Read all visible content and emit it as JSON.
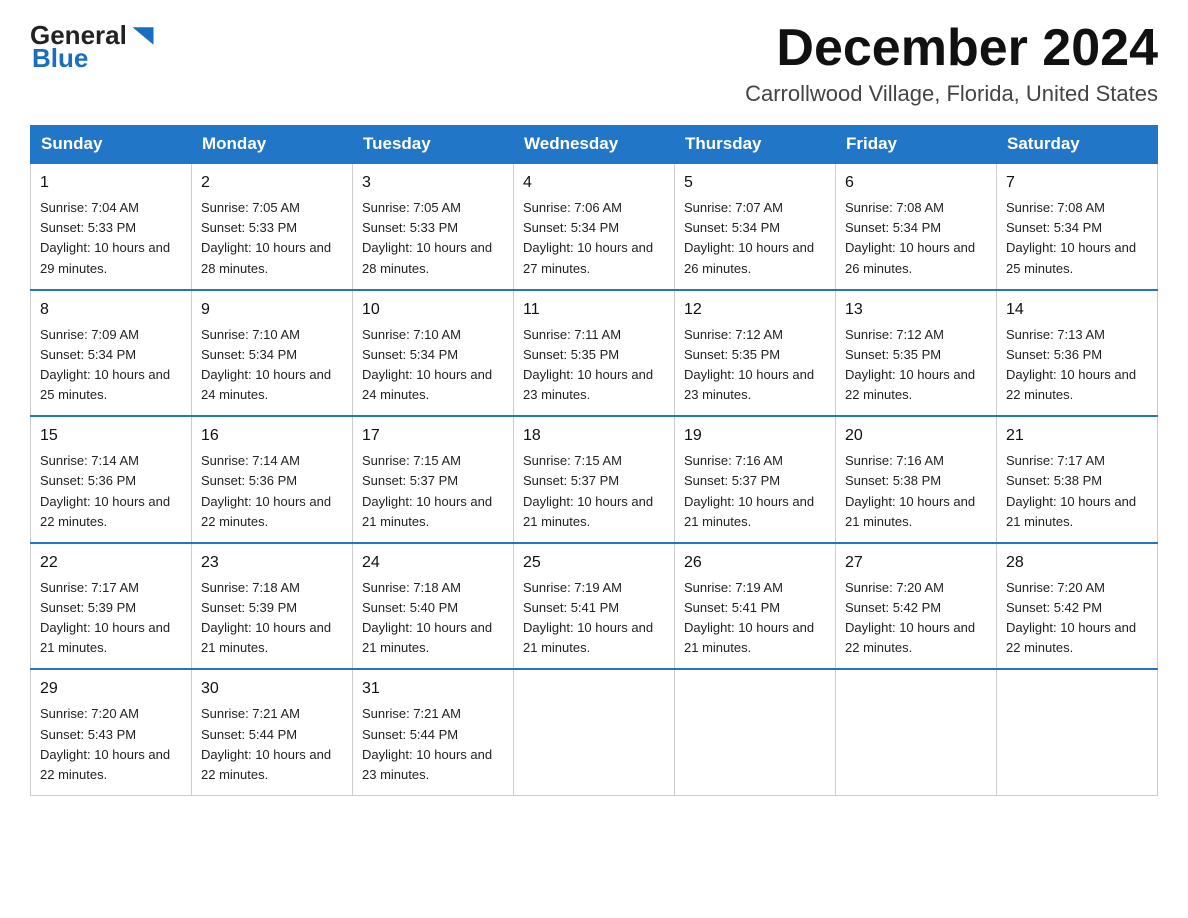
{
  "header": {
    "logo_general": "General",
    "logo_blue": "Blue",
    "month": "December 2024",
    "location": "Carrollwood Village, Florida, United States"
  },
  "weekdays": [
    "Sunday",
    "Monday",
    "Tuesday",
    "Wednesday",
    "Thursday",
    "Friday",
    "Saturday"
  ],
  "weeks": [
    [
      {
        "day": "1",
        "sunrise": "7:04 AM",
        "sunset": "5:33 PM",
        "daylight": "10 hours and 29 minutes."
      },
      {
        "day": "2",
        "sunrise": "7:05 AM",
        "sunset": "5:33 PM",
        "daylight": "10 hours and 28 minutes."
      },
      {
        "day": "3",
        "sunrise": "7:05 AM",
        "sunset": "5:33 PM",
        "daylight": "10 hours and 28 minutes."
      },
      {
        "day": "4",
        "sunrise": "7:06 AM",
        "sunset": "5:34 PM",
        "daylight": "10 hours and 27 minutes."
      },
      {
        "day": "5",
        "sunrise": "7:07 AM",
        "sunset": "5:34 PM",
        "daylight": "10 hours and 26 minutes."
      },
      {
        "day": "6",
        "sunrise": "7:08 AM",
        "sunset": "5:34 PM",
        "daylight": "10 hours and 26 minutes."
      },
      {
        "day": "7",
        "sunrise": "7:08 AM",
        "sunset": "5:34 PM",
        "daylight": "10 hours and 25 minutes."
      }
    ],
    [
      {
        "day": "8",
        "sunrise": "7:09 AM",
        "sunset": "5:34 PM",
        "daylight": "10 hours and 25 minutes."
      },
      {
        "day": "9",
        "sunrise": "7:10 AM",
        "sunset": "5:34 PM",
        "daylight": "10 hours and 24 minutes."
      },
      {
        "day": "10",
        "sunrise": "7:10 AM",
        "sunset": "5:34 PM",
        "daylight": "10 hours and 24 minutes."
      },
      {
        "day": "11",
        "sunrise": "7:11 AM",
        "sunset": "5:35 PM",
        "daylight": "10 hours and 23 minutes."
      },
      {
        "day": "12",
        "sunrise": "7:12 AM",
        "sunset": "5:35 PM",
        "daylight": "10 hours and 23 minutes."
      },
      {
        "day": "13",
        "sunrise": "7:12 AM",
        "sunset": "5:35 PM",
        "daylight": "10 hours and 22 minutes."
      },
      {
        "day": "14",
        "sunrise": "7:13 AM",
        "sunset": "5:36 PM",
        "daylight": "10 hours and 22 minutes."
      }
    ],
    [
      {
        "day": "15",
        "sunrise": "7:14 AM",
        "sunset": "5:36 PM",
        "daylight": "10 hours and 22 minutes."
      },
      {
        "day": "16",
        "sunrise": "7:14 AM",
        "sunset": "5:36 PM",
        "daylight": "10 hours and 22 minutes."
      },
      {
        "day": "17",
        "sunrise": "7:15 AM",
        "sunset": "5:37 PM",
        "daylight": "10 hours and 21 minutes."
      },
      {
        "day": "18",
        "sunrise": "7:15 AM",
        "sunset": "5:37 PM",
        "daylight": "10 hours and 21 minutes."
      },
      {
        "day": "19",
        "sunrise": "7:16 AM",
        "sunset": "5:37 PM",
        "daylight": "10 hours and 21 minutes."
      },
      {
        "day": "20",
        "sunrise": "7:16 AM",
        "sunset": "5:38 PM",
        "daylight": "10 hours and 21 minutes."
      },
      {
        "day": "21",
        "sunrise": "7:17 AM",
        "sunset": "5:38 PM",
        "daylight": "10 hours and 21 minutes."
      }
    ],
    [
      {
        "day": "22",
        "sunrise": "7:17 AM",
        "sunset": "5:39 PM",
        "daylight": "10 hours and 21 minutes."
      },
      {
        "day": "23",
        "sunrise": "7:18 AM",
        "sunset": "5:39 PM",
        "daylight": "10 hours and 21 minutes."
      },
      {
        "day": "24",
        "sunrise": "7:18 AM",
        "sunset": "5:40 PM",
        "daylight": "10 hours and 21 minutes."
      },
      {
        "day": "25",
        "sunrise": "7:19 AM",
        "sunset": "5:41 PM",
        "daylight": "10 hours and 21 minutes."
      },
      {
        "day": "26",
        "sunrise": "7:19 AM",
        "sunset": "5:41 PM",
        "daylight": "10 hours and 21 minutes."
      },
      {
        "day": "27",
        "sunrise": "7:20 AM",
        "sunset": "5:42 PM",
        "daylight": "10 hours and 22 minutes."
      },
      {
        "day": "28",
        "sunrise": "7:20 AM",
        "sunset": "5:42 PM",
        "daylight": "10 hours and 22 minutes."
      }
    ],
    [
      {
        "day": "29",
        "sunrise": "7:20 AM",
        "sunset": "5:43 PM",
        "daylight": "10 hours and 22 minutes."
      },
      {
        "day": "30",
        "sunrise": "7:21 AM",
        "sunset": "5:44 PM",
        "daylight": "10 hours and 22 minutes."
      },
      {
        "day": "31",
        "sunrise": "7:21 AM",
        "sunset": "5:44 PM",
        "daylight": "10 hours and 23 minutes."
      },
      null,
      null,
      null,
      null
    ]
  ]
}
